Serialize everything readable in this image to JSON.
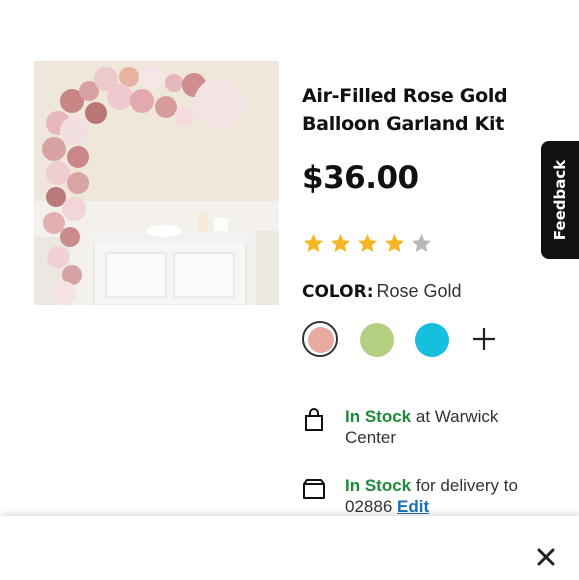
{
  "product": {
    "title": "Air-Filled Rose Gold Balloon Garland Kit",
    "price": "$36.00",
    "rating": 4,
    "rating_max": 5,
    "image_icon": "balloon-garland-photo"
  },
  "color": {
    "label": "COLOR:",
    "selected": "Rose Gold",
    "swatches": [
      {
        "name": "rose-gold",
        "hex": "#e8a9a0",
        "selected": true
      },
      {
        "name": "sage",
        "hex": "#b5cf82",
        "selected": false
      },
      {
        "name": "cyan",
        "hex": "#17bfdf",
        "selected": false
      }
    ],
    "more_icon": "plus-icon"
  },
  "availability": {
    "pickup": {
      "status": "In Stock",
      "detail": "at Warwick Center",
      "icon": "shopping-bag-icon"
    },
    "delivery": {
      "status": "In Stock",
      "detail": "for delivery to",
      "zip": "02886",
      "edit_label": "Edit",
      "icon": "box-icon"
    }
  },
  "feedback": {
    "label": "Feedback"
  },
  "colors": {
    "accent_green": "#1e8a3a",
    "link_blue": "#1b6fb7",
    "star": "#f5b824",
    "star_empty": "#b8b8b8"
  }
}
